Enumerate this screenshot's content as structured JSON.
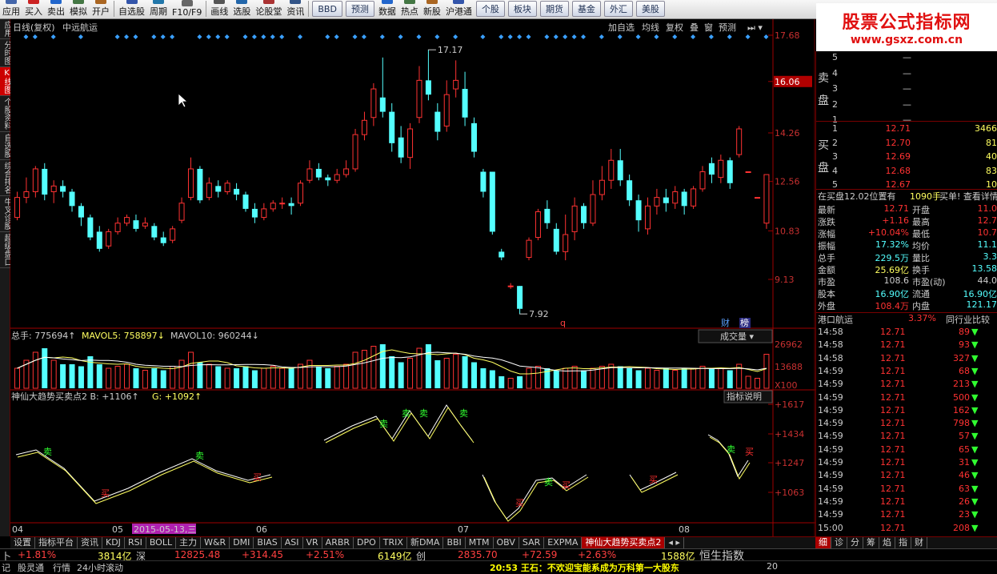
{
  "toolbar": {
    "items": [
      "应用",
      "买入",
      "卖出",
      "模拟",
      "开户",
      "自选股",
      "周期",
      "F10/F9",
      "画线",
      "选股",
      "论股堂",
      "资讯",
      "BBD",
      "预测",
      "数据",
      "热点",
      "新股",
      "沪港通",
      "个股",
      "板块",
      "期货",
      "基金",
      "外汇",
      "美股"
    ]
  },
  "logo": {
    "line1": "股票公式指标网",
    "line2": "www.gsxz.com.cn"
  },
  "left_tabs": [
    "应用",
    "分时图",
    "K线图",
    "个股资料",
    "自选股",
    "综合排名",
    "牛叉诊股",
    "超级盘口"
  ],
  "chart_header": {
    "period": "日线(复权)",
    "stock": "中远航运",
    "buttons": [
      "加自选",
      "均线",
      "复权",
      "叠",
      "窗",
      "预测"
    ]
  },
  "chart_data": {
    "type": "candlestick",
    "price_axis": [
      "17.68",
      "16.06",
      "14.26",
      "12.56",
      "10.83",
      "9.13"
    ],
    "highlighted_price": "16.06",
    "high_label": "17.17",
    "low_label": "7.92",
    "date_labels": [
      "04",
      "05",
      "2015-05-13,三",
      "06",
      "07",
      "08"
    ],
    "candles": [
      [
        0,
        11.3,
        12.0,
        11.2,
        12.2
      ],
      [
        1,
        12.0,
        12.2,
        11.8,
        12.7
      ],
      [
        2,
        12.2,
        13.0,
        12.0,
        13.1
      ],
      [
        3,
        13.0,
        12.1,
        11.9,
        13.2
      ],
      [
        4,
        12.2,
        12.4,
        11.8,
        12.6
      ],
      [
        5,
        12.4,
        12.2,
        12.0,
        12.6
      ],
      [
        6,
        12.2,
        11.7,
        11.5,
        12.3
      ],
      [
        7,
        11.7,
        11.3,
        11.0,
        11.8
      ],
      [
        8,
        11.3,
        10.6,
        10.5,
        11.4
      ],
      [
        9,
        10.8,
        10.2,
        10.1,
        11.0
      ],
      [
        10,
        10.3,
        10.8,
        10.2,
        10.9
      ],
      [
        11,
        10.8,
        11.1,
        10.7,
        11.3
      ],
      [
        12,
        11.1,
        11.3,
        11.0,
        11.4
      ],
      [
        13,
        11.2,
        10.9,
        10.8,
        11.4
      ],
      [
        14,
        11.0,
        11.1,
        10.9,
        11.3
      ],
      [
        15,
        11.0,
        10.6,
        10.5,
        11.1
      ],
      [
        16,
        10.6,
        10.4,
        10.3,
        10.8
      ],
      [
        17,
        10.5,
        10.9,
        10.4,
        11.0
      ],
      [
        18,
        11.2,
        11.8,
        11.1,
        12.0
      ],
      [
        19,
        12.0,
        13.0,
        11.9,
        13.4
      ],
      [
        20,
        13.0,
        11.9,
        11.8,
        13.1
      ],
      [
        21,
        12.0,
        12.5,
        11.9,
        12.7
      ],
      [
        22,
        12.4,
        12.2,
        12.0,
        12.6
      ],
      [
        23,
        12.2,
        12.5,
        12.1,
        12.6
      ],
      [
        24,
        12.3,
        12.1,
        11.9,
        12.5
      ],
      [
        25,
        12.1,
        11.6,
        11.5,
        12.2
      ],
      [
        26,
        11.6,
        11.3,
        11.1,
        11.8
      ],
      [
        27,
        11.3,
        11.6,
        11.2,
        11.8
      ],
      [
        28,
        11.6,
        11.8,
        11.5,
        11.9
      ],
      [
        29,
        11.8,
        11.8,
        11.6,
        12.0
      ],
      [
        30,
        11.8,
        11.7,
        11.4,
        12.0
      ],
      [
        31,
        11.8,
        12.5,
        11.7,
        12.6
      ],
      [
        32,
        12.6,
        13.0,
        12.5,
        13.3
      ],
      [
        33,
        13.0,
        12.7,
        12.6,
        13.2
      ],
      [
        34,
        12.7,
        12.6,
        12.4,
        12.8
      ],
      [
        35,
        12.6,
        12.8,
        12.5,
        13.0
      ],
      [
        36,
        12.8,
        13.0,
        12.7,
        13.3
      ],
      [
        37,
        13.0,
        14.2,
        12.9,
        14.4
      ],
      [
        38,
        14.2,
        14.7,
        14.0,
        15.0
      ],
      [
        39,
        14.8,
        15.8,
        14.5,
        16.0
      ],
      [
        40,
        15.5,
        15.0,
        14.8,
        16.9
      ],
      [
        41,
        15.0,
        13.9,
        13.6,
        15.3
      ],
      [
        42,
        14.1,
        13.4,
        13.2,
        14.5
      ],
      [
        43,
        13.4,
        14.4,
        13.0,
        14.6
      ],
      [
        44,
        14.8,
        16.1,
        14.6,
        16.6
      ],
      [
        45,
        16.1,
        15.6,
        15.4,
        17.17
      ],
      [
        46,
        15.0,
        14.3,
        14.0,
        15.3
      ],
      [
        47,
        14.5,
        15.6,
        14.3,
        16.1
      ],
      [
        48,
        15.8,
        16.1,
        15.5,
        16.8
      ],
      [
        49,
        15.8,
        14.8,
        14.5,
        16.4
      ],
      [
        50,
        14.6,
        13.6,
        13.4,
        14.8
      ],
      [
        51,
        12.9,
        12.2,
        12.0,
        13.0
      ],
      [
        52,
        12.9,
        10.8,
        10.7,
        12.9
      ],
      [
        53,
        10.1,
        9.9,
        9.8,
        10.2
      ],
      [
        54,
        8.9,
        8.9,
        8.8,
        9.0
      ],
      [
        55,
        8.9,
        8.1,
        7.92,
        8.9
      ],
      [
        56,
        9.9,
        10.5,
        9.8,
        10.6
      ],
      [
        57,
        10.6,
        11.5,
        10.5,
        11.6
      ],
      [
        58,
        11.6,
        11.1,
        10.9,
        11.9
      ],
      [
        59,
        10.9,
        10.1,
        10.0,
        11.1
      ],
      [
        60,
        10.1,
        10.7,
        9.8,
        11.4
      ],
      [
        61,
        10.8,
        11.7,
        10.5,
        12.0
      ],
      [
        62,
        11.7,
        11.1,
        10.9,
        11.8
      ],
      [
        63,
        11.1,
        12.1,
        11.0,
        12.6
      ],
      [
        64,
        12.1,
        12.6,
        11.9,
        13.1
      ],
      [
        65,
        12.6,
        13.3,
        12.3,
        13.7
      ],
      [
        66,
        13.3,
        12.6,
        12.4,
        13.7
      ],
      [
        67,
        12.6,
        11.9,
        11.7,
        12.8
      ],
      [
        68,
        11.9,
        11.2,
        10.8,
        12.1
      ],
      [
        69,
        10.9,
        11.7,
        10.7,
        12.0
      ],
      [
        70,
        11.7,
        12.0,
        11.4,
        12.3
      ],
      [
        71,
        12.0,
        11.8,
        11.5,
        12.3
      ],
      [
        72,
        11.8,
        12.2,
        11.6,
        12.4
      ],
      [
        73,
        12.2,
        11.7,
        11.4,
        12.3
      ],
      [
        74,
        11.7,
        12.3,
        11.6,
        12.4
      ],
      [
        75,
        12.3,
        12.9,
        12.2,
        13.1
      ],
      [
        76,
        13.2,
        12.8,
        12.5,
        13.4
      ],
      [
        77,
        12.7,
        13.3,
        12.5,
        13.5
      ],
      [
        78,
        13.3,
        12.5,
        12.3,
        13.4
      ],
      [
        79,
        13.5,
        14.4,
        13.4,
        14.5
      ],
      [
        80,
        12.9,
        12.9,
        12.9,
        12.9
      ],
      [
        81,
        12.0,
        12.0,
        12.0,
        12.0
      ],
      [
        82,
        11.1,
        12.8,
        10.9,
        12.8
      ]
    ],
    "volume_label": "总手: 775694",
    "mavol5_label": "MAVOL5: 758897",
    "mavol10_label": "MAVOL10: 960244",
    "volume_axis": [
      "26962",
      "13688",
      "X100"
    ],
    "volume_dropdown": "成交量",
    "volumes": [
      10,
      14,
      18,
      20,
      14,
      12,
      12,
      11,
      16,
      12,
      10,
      11,
      12,
      10,
      9,
      10,
      9,
      11,
      14,
      18,
      13,
      12,
      11,
      10,
      10,
      11,
      9,
      10,
      11,
      10,
      10,
      12,
      14,
      11,
      10,
      11,
      12,
      18,
      19,
      21,
      22,
      16,
      13,
      15,
      20,
      22,
      14,
      15,
      17,
      16,
      13,
      10,
      9,
      6,
      5,
      6,
      10,
      11,
      10,
      9,
      10,
      11,
      9,
      10,
      11,
      12,
      11,
      10,
      9,
      10,
      9,
      10,
      9,
      10,
      10,
      11,
      10,
      10,
      9,
      12,
      6,
      5,
      17
    ],
    "indicator_name": "神仙大趋势买卖点2",
    "indicator_b": "B: +1106",
    "indicator_g": "G: +1092",
    "indicator_axis": [
      "+1617",
      "+1434",
      "+1247",
      "+1063"
    ],
    "indicator_button": "指标说明",
    "labels_sell": "卖",
    "labels_buy": "买",
    "badges": [
      "财",
      "榜"
    ],
    "badge_q": "q"
  },
  "quote": {
    "sell": [
      {
        "n": "5",
        "p": "",
        "v": "—"
      },
      {
        "n": "4",
        "p": "",
        "v": "—"
      },
      {
        "n": "3",
        "p": "",
        "v": "—"
      },
      {
        "n": "2",
        "p": "",
        "v": "—"
      },
      {
        "n": "1",
        "p": "",
        "v": "—"
      }
    ],
    "sell_label": "卖盘",
    "buy_label": "买盘",
    "buy": [
      {
        "n": "1",
        "p": "12.71",
        "v": "3466"
      },
      {
        "n": "2",
        "p": "12.70",
        "v": "81"
      },
      {
        "n": "3",
        "p": "12.69",
        "v": "40"
      },
      {
        "n": "4",
        "p": "12.68",
        "v": "83"
      },
      {
        "n": "5",
        "p": "12.67",
        "v": "10"
      }
    ],
    "buy_info": "在买盘12.02位置有",
    "buy_info_vol": "1090手",
    "buy_info_tail": "买单! 查看详情",
    "stats": [
      [
        "最新",
        "12.71",
        "开盘",
        "11.0"
      ],
      [
        "涨跌",
        "+1.16",
        "最高",
        "12.7"
      ],
      [
        "涨幅",
        "+10.04%",
        "最低",
        "10.7"
      ],
      [
        "振幅",
        "17.32%",
        "均价",
        "11.1"
      ],
      [
        "总手",
        "229.5万",
        "量比",
        "3.3"
      ],
      [
        "金额",
        "25.69亿",
        "换手",
        "13.58"
      ],
      [
        "市盈",
        "108.6",
        "市盈(动)",
        "44.0"
      ],
      [
        "股本",
        "16.90亿",
        "流通",
        "16.90亿"
      ],
      [
        "外盘",
        "108.4万",
        "内盘",
        "121.17"
      ]
    ],
    "industry": "港口航运",
    "industry_pct": "3.37%",
    "industry_btn": "同行业比较",
    "ticks": [
      [
        "14:58",
        "12.71",
        "89"
      ],
      [
        "14:58",
        "12.71",
        "93"
      ],
      [
        "14:58",
        "12.71",
        "327"
      ],
      [
        "14:59",
        "12.71",
        "68"
      ],
      [
        "14:59",
        "12.71",
        "213"
      ],
      [
        "14:59",
        "12.71",
        "500"
      ],
      [
        "14:59",
        "12.71",
        "162"
      ],
      [
        "14:59",
        "12.71",
        "798"
      ],
      [
        "14:59",
        "12.71",
        "57"
      ],
      [
        "14:59",
        "12.71",
        "65"
      ],
      [
        "14:59",
        "12.71",
        "31"
      ],
      [
        "14:59",
        "12.71",
        "46"
      ],
      [
        "14:59",
        "12.71",
        "63"
      ],
      [
        "14:59",
        "12.71",
        "26"
      ],
      [
        "14:59",
        "12.71",
        "23"
      ],
      [
        "15:00",
        "12.71",
        "208"
      ]
    ]
  },
  "bottom_tabs": [
    "设置",
    "指标平台",
    "资讯",
    "KDJ",
    "RSI",
    "BOLL",
    "主力",
    "W&R",
    "DMI",
    "BIAS",
    "ASI",
    "VR",
    "ARBR",
    "DPO",
    "TRIX",
    "新DMA",
    "BBI",
    "MTM",
    "OBV",
    "SAR",
    "EXPMA",
    "神仙大趋势买卖点2"
  ],
  "right_tabs": [
    "细",
    "诊",
    "分",
    "筹",
    "焰",
    "指",
    "财"
  ],
  "status": {
    "a1": "+1.81%",
    "a2": "3814亿",
    "a3": "深",
    "a4": "12825.48",
    "a5": "+314.45",
    "a6": "+2.51%",
    "a7": "6149亿",
    "a8": "创",
    "a9": "2835.70",
    "a10": "+72.59",
    "a11": "+2.63%",
    "a12": "1588亿",
    "a13": "恒生指数"
  },
  "status2": {
    "b1": "记",
    "b2": "股灵通",
    "b3": "行情",
    "b4": "24小时滚动",
    "b5": "20:53 王石：不欢迎宝能系成为万科第一大股东",
    "b6": "20"
  }
}
